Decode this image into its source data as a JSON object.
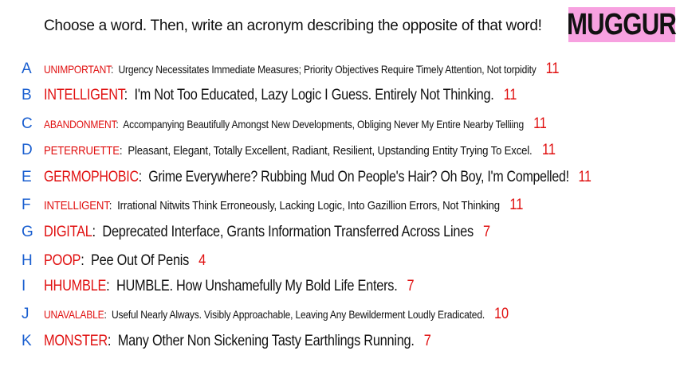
{
  "prompt": "Choose a word. Then, write an acronym describing the opposite of that word!",
  "logo": "MUGGUR",
  "colors": {
    "word": "#e01010",
    "letter": "#1a5fd0",
    "logo_bg": "#f7a1e0"
  },
  "rows": [
    {
      "letter": "A",
      "word": "UNIMPORTANT",
      "text": "Urgency Necessitates Immediate Measures; Priority Objectives Require Timely Attention, Not torpidity",
      "count": "11"
    },
    {
      "letter": "B",
      "word": "INTELLIGENT",
      "text": "I'm Not Too Educated, Lazy Logic I Guess. Entirely Not Thinking.",
      "count": "11"
    },
    {
      "letter": "C",
      "word": "ABANDONMENT",
      "text": "Accompanying Beautifully Amongst New Developments, Obliging Never My Entire Nearby Telliing",
      "count": "11"
    },
    {
      "letter": "D",
      "word": "PETERRUETTE",
      "text": "Pleasant, Elegant, Totally Excellent, Radiant, Resilient, Upstanding Entity Trying To Excel.",
      "count": "11"
    },
    {
      "letter": "E",
      "word": "GERMOPHOBIC",
      "text": "Grime Everywhere? Rubbing Mud On People's Hair? Oh Boy, I'm Compelled!",
      "count": "11"
    },
    {
      "letter": "F",
      "word": "INTELLIGENT",
      "text": "Irrational Nitwits Think Erroneously, Lacking Logic, Into Gazillion Errors, Not Thinking",
      "count": "11"
    },
    {
      "letter": "G",
      "word": "DIGITAL",
      "text": "Deprecated Interface, Grants Information Transferred Across Lines",
      "count": "7"
    },
    {
      "letter": "H",
      "word": "POOP",
      "text": "Pee Out Of Penis",
      "count": "4"
    },
    {
      "letter": "I",
      "word": "HHUMBLE",
      "text": "HUMBLE. How Unshamefully My Bold Life Enters.",
      "count": "7"
    },
    {
      "letter": "J",
      "word": "UNAVALABLE",
      "text": "Useful Nearly Always. Visibly Approachable, Leaving Any Bewilderment Loudly Eradicated.",
      "count": "10"
    },
    {
      "letter": "K",
      "word": "MONSTER",
      "text": "Many Other Non Sickening Tasty Earthlings Running.",
      "count": "7"
    }
  ]
}
